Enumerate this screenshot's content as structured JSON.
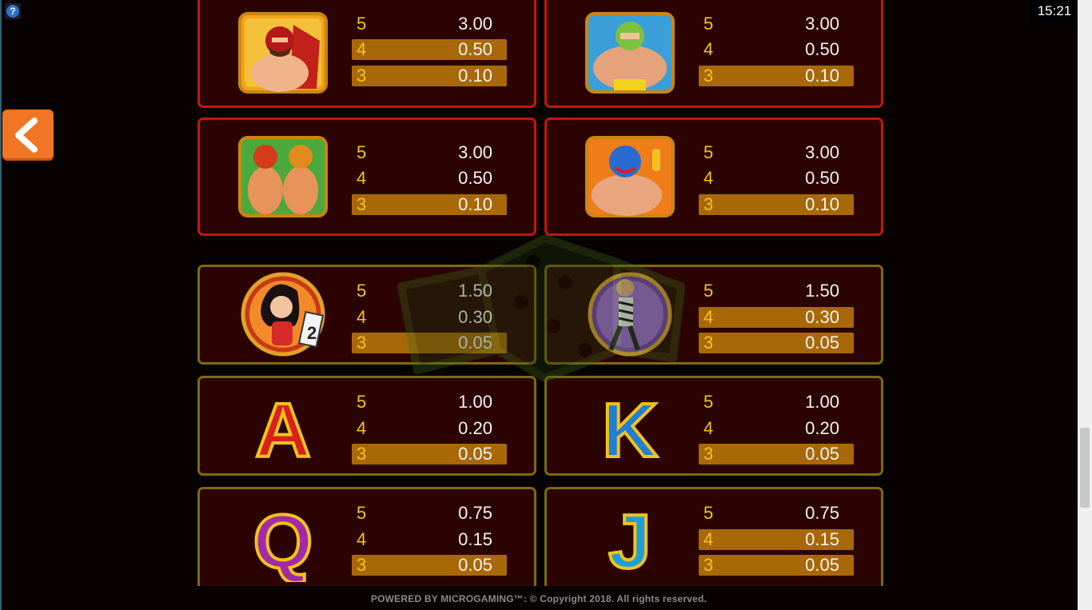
{
  "clock": "15:21",
  "help_glyph": "?",
  "colors": {
    "red_border": "#c41514",
    "olive_border": "#7b6b0e",
    "highlight": "#a96808",
    "count_text": "#f7c21f"
  },
  "paytable": [
    {
      "symbol": "masked-wrestler-red-cape",
      "pays": [
        {
          "count": "5",
          "value": "3.00"
        },
        {
          "count": "4",
          "value": "0.50"
        },
        {
          "count": "3",
          "value": "0.10"
        }
      ]
    },
    {
      "symbol": "green-masked-muscle-wrestler",
      "pays": [
        {
          "count": "5",
          "value": "3.00"
        },
        {
          "count": "4",
          "value": "0.50"
        },
        {
          "count": "3",
          "value": "0.10"
        }
      ]
    },
    {
      "symbol": "tag-team-wrestlers",
      "pays": [
        {
          "count": "5",
          "value": "3.00"
        },
        {
          "count": "4",
          "value": "0.50"
        },
        {
          "count": "3",
          "value": "0.10"
        }
      ]
    },
    {
      "symbol": "blue-masked-wrestler",
      "pays": [
        {
          "count": "5",
          "value": "3.00"
        },
        {
          "count": "4",
          "value": "0.50"
        },
        {
          "count": "3",
          "value": "0.10"
        }
      ]
    },
    {
      "symbol": "ring-girl",
      "round_card": "2",
      "pays": [
        {
          "count": "5",
          "value": "1.50"
        },
        {
          "count": "4",
          "value": "0.30"
        },
        {
          "count": "3",
          "value": "0.05"
        }
      ]
    },
    {
      "symbol": "referee",
      "pays": [
        {
          "count": "5",
          "value": "1.50"
        },
        {
          "count": "4",
          "value": "0.30"
        },
        {
          "count": "3",
          "value": "0.05"
        }
      ]
    },
    {
      "symbol": "letter-a",
      "letter": "A",
      "pays": [
        {
          "count": "5",
          "value": "1.00"
        },
        {
          "count": "4",
          "value": "0.20"
        },
        {
          "count": "3",
          "value": "0.05"
        }
      ]
    },
    {
      "symbol": "letter-k",
      "letter": "K",
      "pays": [
        {
          "count": "5",
          "value": "1.00"
        },
        {
          "count": "4",
          "value": "0.20"
        },
        {
          "count": "3",
          "value": "0.05"
        }
      ]
    },
    {
      "symbol": "letter-q",
      "letter": "Q",
      "pays": [
        {
          "count": "5",
          "value": "0.75"
        },
        {
          "count": "4",
          "value": "0.15"
        },
        {
          "count": "3",
          "value": "0.05"
        }
      ]
    },
    {
      "symbol": "letter-j",
      "letter": "J",
      "pays": [
        {
          "count": "5",
          "value": "0.75"
        },
        {
          "count": "4",
          "value": "0.15"
        },
        {
          "count": "3",
          "value": "0.05"
        }
      ]
    }
  ],
  "footer": "POWERED BY MICROGAMING™: © Copyright 2018. All rights reserved."
}
